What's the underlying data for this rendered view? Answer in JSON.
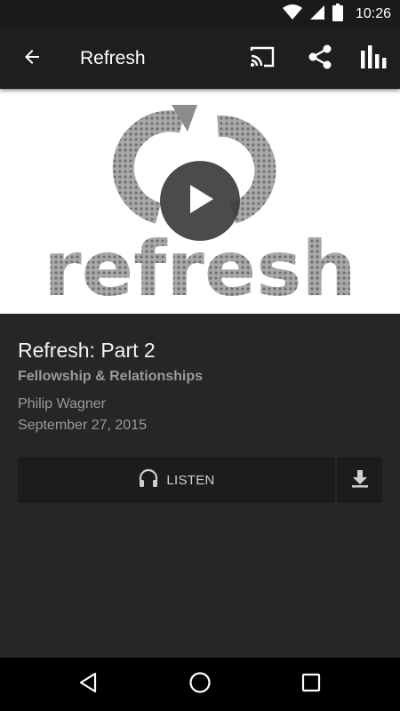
{
  "status_bar": {
    "time": "10:26"
  },
  "app_bar": {
    "title": "Refresh"
  },
  "hero": {
    "artwork_text": "refresh"
  },
  "sermon": {
    "title": "Refresh: Part 2",
    "series": "Fellowship & Relationships",
    "speaker": "Philip Wagner",
    "date": "September 27, 2015"
  },
  "actions": {
    "listen_label": "LISTEN"
  },
  "icons": {
    "wifi": "wifi-icon",
    "signal": "cell-signal-icon",
    "battery": "battery-icon",
    "back": "arrow-back-icon",
    "cast": "cast-icon",
    "share": "share-icon",
    "stats": "bar-chart-icon",
    "play": "play-icon",
    "headphones": "headphones-icon",
    "download": "download-icon",
    "nav_back": "nav-back-icon",
    "nav_home": "nav-home-icon",
    "nav_recents": "nav-recents-icon"
  },
  "colors": {
    "background": "#262626",
    "app_bar": "#1e1e1e",
    "status_bar": "#1a1a1a",
    "secondary_text": "#9a9a9a",
    "hero_background": "#ffffff",
    "artwork_gray": "#8c8c8c"
  }
}
